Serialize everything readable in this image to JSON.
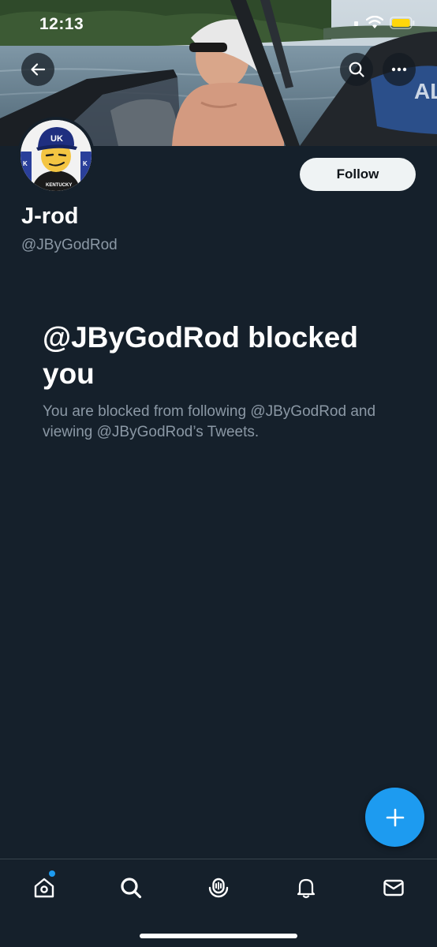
{
  "status_bar": {
    "time": "12:13"
  },
  "banner": {
    "description_icon": "banner-photo"
  },
  "profile": {
    "display_name": "J-rod",
    "handle": "@JByGodRod",
    "follow_label": "Follow"
  },
  "blocked": {
    "title": "@JByGodRod blocked you",
    "description": "You are blocked from following @JByGodRod and viewing @JByGodRod’s Tweets."
  },
  "nav": {
    "items": [
      {
        "name": "home",
        "icon": "home-icon",
        "has_unread": true
      },
      {
        "name": "search",
        "icon": "search-icon"
      },
      {
        "name": "spaces",
        "icon": "spaces-icon"
      },
      {
        "name": "notifications",
        "icon": "bell-icon"
      },
      {
        "name": "messages",
        "icon": "envelope-icon"
      }
    ]
  },
  "colors": {
    "background": "#15202b",
    "accent": "#1d9bf0",
    "secondary_text": "#8b98a5",
    "follow_bg": "#eff3f4",
    "battery": "#ffd60a"
  }
}
